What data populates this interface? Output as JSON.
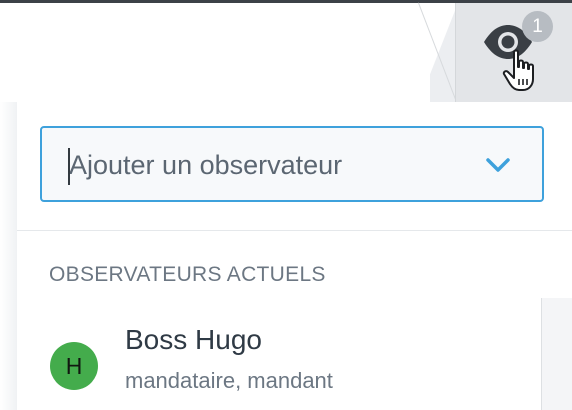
{
  "watchers": {
    "count": "1",
    "icon": "eye-icon",
    "accent_color": "#3ea1dc"
  },
  "add_watcher": {
    "placeholder": "Ajouter un observateur"
  },
  "current_watchers": {
    "title": "OBSERVATEURS ACTUELS",
    "items": [
      {
        "initial": "H",
        "name": "Boss Hugo",
        "role": "mandataire, mandant",
        "avatar_color": "#44ac4c"
      }
    ]
  }
}
